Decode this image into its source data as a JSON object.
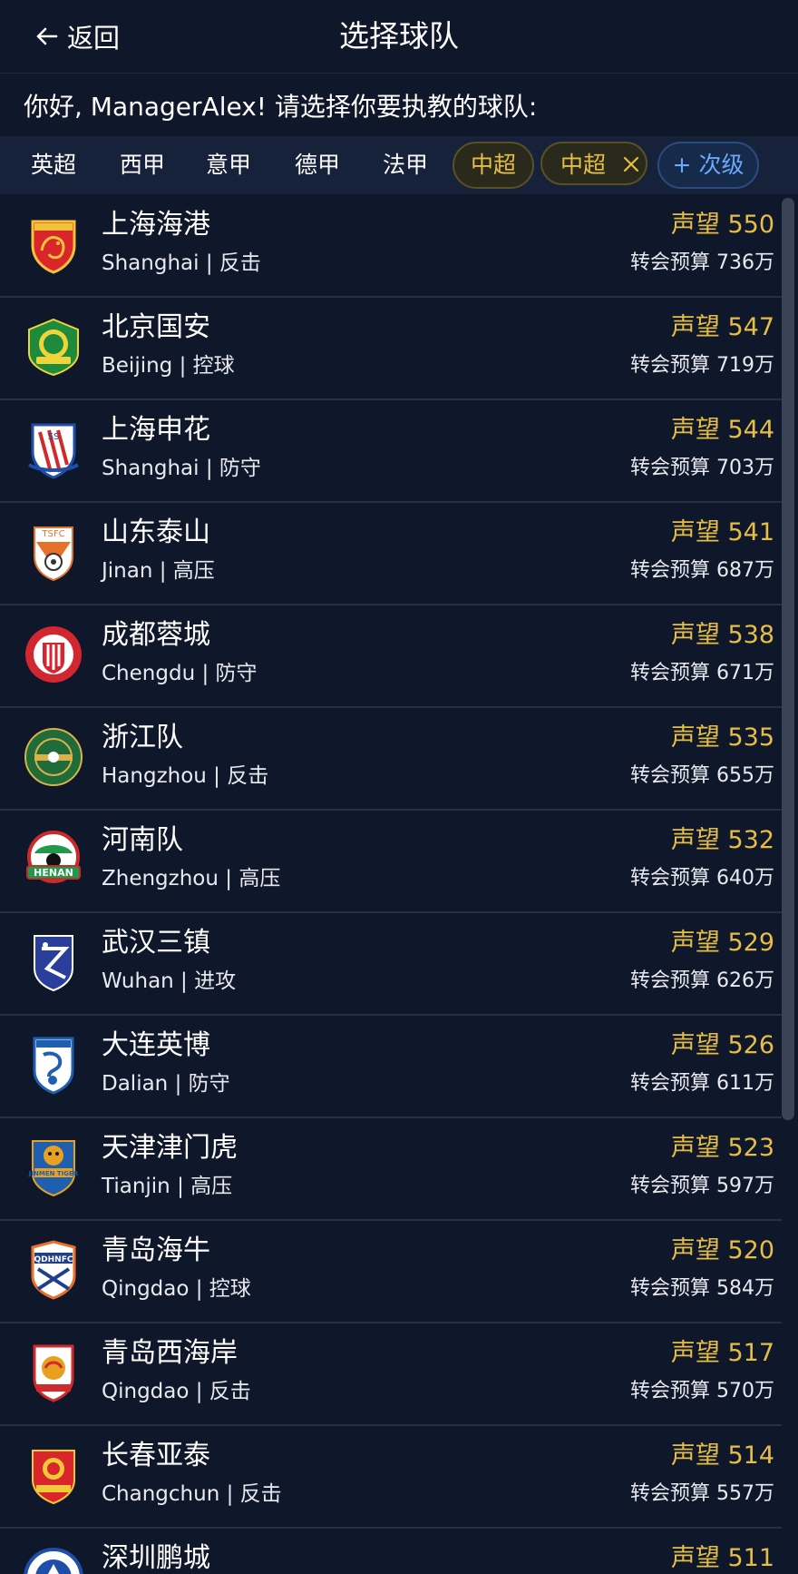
{
  "header": {
    "back_label": "返回",
    "title": "选择球队"
  },
  "greeting": "你好, ManagerAlex! 请选择你要执教的球队:",
  "tabs": [
    {
      "label": "英超"
    },
    {
      "label": "西甲"
    },
    {
      "label": "意甲"
    },
    {
      "label": "德甲"
    },
    {
      "label": "法甲"
    },
    {
      "label": "中超"
    },
    {
      "label": "中超"
    },
    {
      "label": "+ 次级"
    }
  ],
  "teams": [
    {
      "name": "上海海港",
      "sub": "Shanghai | 反击",
      "reputation": "声望 550",
      "budget": "转会预算 736万",
      "logo": "shanghai-port-crest"
    },
    {
      "name": "北京国安",
      "sub": "Beijing | 控球",
      "reputation": "声望 547",
      "budget": "转会预算 719万",
      "logo": "beijing-guoan-crest"
    },
    {
      "name": "上海申花",
      "sub": "Shanghai | 防守",
      "reputation": "声望 544",
      "budget": "转会预算 703万",
      "logo": "shanghai-shenhua-crest"
    },
    {
      "name": "山东泰山",
      "sub": "Jinan | 高压",
      "reputation": "声望 541",
      "budget": "转会预算 687万",
      "logo": "shandong-taishan-crest"
    },
    {
      "name": "成都蓉城",
      "sub": "Chengdu | 防守",
      "reputation": "声望 538",
      "budget": "转会预算 671万",
      "logo": "chengdu-rongcheng-crest"
    },
    {
      "name": "浙江队",
      "sub": "Hangzhou | 反击",
      "reputation": "声望 535",
      "budget": "转会预算 655万",
      "logo": "zhejiang-crest"
    },
    {
      "name": "河南队",
      "sub": "Zhengzhou | 高压",
      "reputation": "声望 532",
      "budget": "转会预算 640万",
      "logo": "henan-crest"
    },
    {
      "name": "武汉三镇",
      "sub": "Wuhan | 进攻",
      "reputation": "声望 529",
      "budget": "转会预算 626万",
      "logo": "wuhan-three-towns-crest"
    },
    {
      "name": "大连英博",
      "sub": "Dalian | 防守",
      "reputation": "声望 526",
      "budget": "转会预算 611万",
      "logo": "dalian-yingbo-crest"
    },
    {
      "name": "天津津门虎",
      "sub": "Tianjin | 高压",
      "reputation": "声望 523",
      "budget": "转会预算 597万",
      "logo": "tianjin-jinmen-tiger-crest"
    },
    {
      "name": "青岛海牛",
      "sub": "Qingdao | 控球",
      "reputation": "声望 520",
      "budget": "转会预算 584万",
      "logo": "qingdao-hainiu-crest"
    },
    {
      "name": "青岛西海岸",
      "sub": "Qingdao | 反击",
      "reputation": "声望 517",
      "budget": "转会预算 570万",
      "logo": "qingdao-west-coast-crest"
    },
    {
      "name": "长春亚泰",
      "sub": "Changchun | 反击",
      "reputation": "声望 514",
      "budget": "转会预算 557万",
      "logo": "changchun-yatai-crest"
    },
    {
      "name": "深圳鹏城",
      "sub": "",
      "reputation": "声望 511",
      "budget": "",
      "logo": "shenzhen-pengcheng-crest"
    }
  ],
  "colors": {
    "background": "#0f172a",
    "tabbar": "#16213a",
    "gold": "#e6bd45",
    "blue_accent": "#6aa8ff",
    "divider": "#22304a"
  }
}
